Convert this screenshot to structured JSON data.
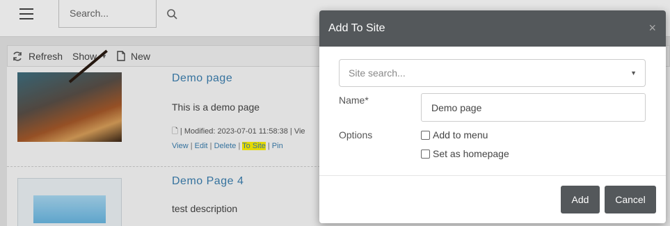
{
  "header": {
    "search_placeholder": "Search..."
  },
  "toolbar": {
    "refresh": "Refresh",
    "show": "Show",
    "new": "New"
  },
  "items": [
    {
      "title": "Demo page",
      "description": "This is a demo page",
      "meta": "| Modified: 2023-07-01 11:58:38 | Vie",
      "links": [
        "View",
        "Edit",
        "Delete",
        "To Site",
        "Pin"
      ]
    },
    {
      "title": "Demo Page 4",
      "description": "test description"
    }
  ],
  "modal": {
    "title": "Add To Site",
    "close": "×",
    "site_search_placeholder": "Site search...",
    "name_label": "Name*",
    "name_value": "Demo page",
    "options_label": "Options",
    "options": [
      "Add to menu",
      "Set as homepage"
    ],
    "add_label": "Add",
    "cancel_label": "Cancel"
  },
  "colors": {
    "header_bg": "#54585b",
    "link": "#3c7fb0",
    "highlight": "#fff200"
  }
}
